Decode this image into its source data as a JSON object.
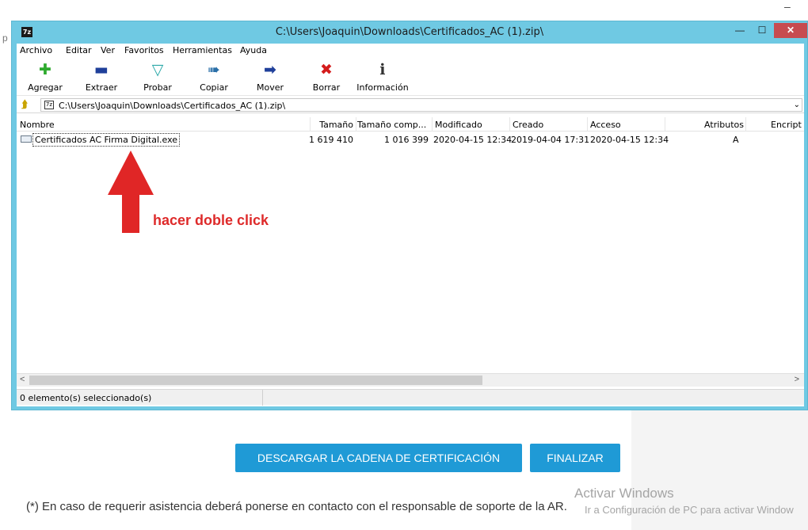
{
  "window": {
    "app_icon": "7z",
    "title": "C:\\Users\\Joaquin\\Downloads\\Certificados_AC (1).zip\\",
    "minimize_icon": "minimize-icon",
    "maximize_icon": "maximize-icon",
    "close_icon": "close-icon",
    "close_glyph": "✕"
  },
  "menu": [
    {
      "label": "Archivo"
    },
    {
      "label": "Editar"
    },
    {
      "label": "Ver"
    },
    {
      "label": "Favoritos"
    },
    {
      "label": "Herramientas"
    },
    {
      "label": "Ayuda"
    }
  ],
  "toolbar": [
    {
      "label": "Agregar",
      "icon": "add-icon",
      "color": "#2eaa2e"
    },
    {
      "label": "Extraer",
      "icon": "extract-icon",
      "color": "#1f3f9a"
    },
    {
      "label": "Probar",
      "icon": "test-icon",
      "color": "#2aa8a8"
    },
    {
      "label": "Copiar",
      "icon": "copy-icon",
      "color": "#2a6fa8"
    },
    {
      "label": "Mover",
      "icon": "move-icon",
      "color": "#1f3f9a"
    },
    {
      "label": "Borrar",
      "icon": "delete-icon",
      "color": "#d41c1c"
    },
    {
      "label": "Información",
      "icon": "info-icon",
      "color": "#333333"
    }
  ],
  "address": {
    "path": "C:\\Users\\Joaquin\\Downloads\\Certificados_AC (1).zip\\"
  },
  "columns": [
    "Nombre",
    "Tamaño",
    "Tamaño comp...",
    "Modificado",
    "Creado",
    "Acceso",
    "Atributos",
    "Encript"
  ],
  "files": [
    {
      "name": "Certificados AC Firma Digital.exe",
      "size": "1 619 410",
      "packed_size": "1 016 399",
      "modified": "2020-04-15 12:34",
      "created": "2019-04-04 17:31",
      "accessed": "2020-04-15 12:34",
      "attributes": "A",
      "encrypted": ""
    }
  ],
  "status": {
    "text": "0 elemento(s) seleccionado(s)"
  },
  "annotation": {
    "text": "hacer doble click",
    "color": "#de2a2a"
  },
  "page": {
    "download_button": "DESCARGAR LA CADENA DE CERTIFICACIÓN",
    "finish_button": "FINALIZAR",
    "footnote": "(*) En caso de requerir asistencia deberá ponerse en contacto con el responsable de soporte de la AR.",
    "accent": "#1f9ad6"
  },
  "watermark": {
    "title": "Activar Windows",
    "subtitle": "Ir a Configuración de PC para activar Window"
  },
  "background": {
    "left_edge_char": "p"
  }
}
